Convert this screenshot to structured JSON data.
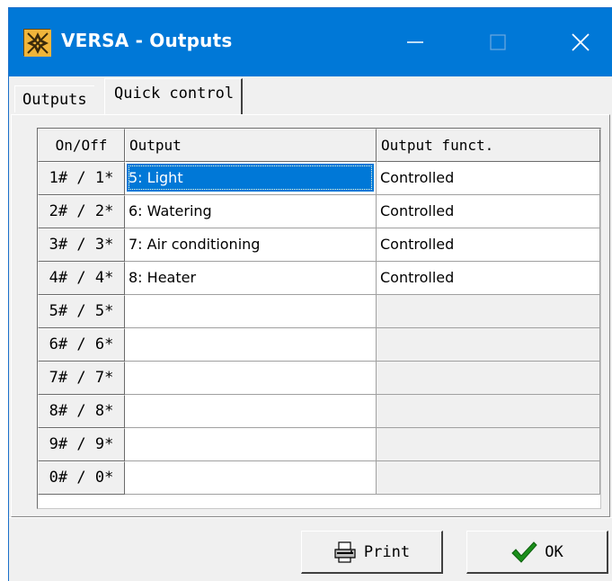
{
  "window": {
    "title": "VERSA - Outputs"
  },
  "tabs": [
    {
      "label": "Outputs",
      "active": false
    },
    {
      "label": "Quick control",
      "active": true
    }
  ],
  "table": {
    "headers": [
      "On/Off",
      "Output",
      "Output funct."
    ],
    "rows": [
      {
        "key": "1# / 1*",
        "output": "5: Light",
        "func": "Controlled",
        "selected": true
      },
      {
        "key": "2# / 2*",
        "output": "6: Watering",
        "func": "Controlled"
      },
      {
        "key": "3# / 3*",
        "output": "7: Air conditioning",
        "func": "Controlled"
      },
      {
        "key": "4# / 4*",
        "output": "8: Heater",
        "func": "Controlled"
      },
      {
        "key": "5# / 5*",
        "output": "",
        "func": ""
      },
      {
        "key": "6# / 6*",
        "output": "",
        "func": ""
      },
      {
        "key": "7# / 7*",
        "output": "",
        "func": ""
      },
      {
        "key": "8# / 8*",
        "output": "",
        "func": ""
      },
      {
        "key": "9# / 9*",
        "output": "",
        "func": ""
      },
      {
        "key": "0# / 0*",
        "output": "",
        "func": ""
      }
    ]
  },
  "buttons": {
    "print_label": "Print",
    "ok_label": "OK"
  },
  "icons": {
    "app": "versa-app-icon",
    "print": "printer-icon",
    "ok": "checkmark-icon"
  },
  "colors": {
    "titlebar": "#0078d7",
    "selection": "#0078d7",
    "checkmark": "#1a8f1a"
  }
}
